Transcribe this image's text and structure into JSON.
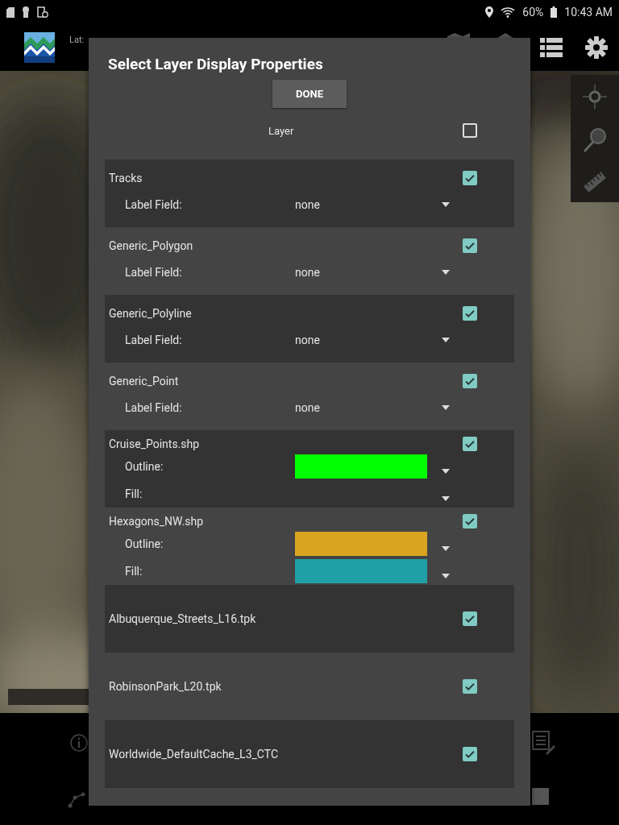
{
  "status_bar": {
    "battery": "60%",
    "time": "10:43 AM"
  },
  "app_bar": {
    "coordinates": "Lat:"
  },
  "dialog": {
    "title": "Select Layer Display Properties",
    "done_button": "DONE",
    "header": {
      "label": "Layer",
      "checked": false
    },
    "layers": [
      {
        "kind": "label",
        "name": "Tracks",
        "checked": true,
        "fields": [
          {
            "label": "Label Field:",
            "value": "none"
          }
        ]
      },
      {
        "kind": "label",
        "name": "Generic_Polygon",
        "checked": true,
        "fields": [
          {
            "label": "Label Field:",
            "value": "none"
          }
        ]
      },
      {
        "kind": "label",
        "name": "Generic_Polyline",
        "checked": true,
        "fields": [
          {
            "label": "Label Field:",
            "value": "none"
          }
        ]
      },
      {
        "kind": "label",
        "name": "Generic_Point",
        "checked": true,
        "fields": [
          {
            "label": "Label Field:",
            "value": "none"
          }
        ]
      },
      {
        "kind": "style",
        "name": "Cruise_Points.shp",
        "checked": true,
        "fields": [
          {
            "label": "Outline:",
            "color": "#00ff00"
          },
          {
            "label": "Fill:"
          }
        ]
      },
      {
        "kind": "style",
        "name": "Hexagons_NW.shp",
        "checked": true,
        "fields": [
          {
            "label": "Outline:",
            "color": "#daa520"
          },
          {
            "label": "Fill:",
            "color": "#20a0a6"
          }
        ]
      },
      {
        "kind": "plain",
        "name": "Albuquerque_Streets_L16.tpk",
        "checked": true
      },
      {
        "kind": "plain",
        "name": "RobinsonPark_L20.tpk",
        "checked": true
      },
      {
        "kind": "plain",
        "name": "Worldwide_DefaultCache_L3_CTC",
        "checked": true
      }
    ]
  }
}
